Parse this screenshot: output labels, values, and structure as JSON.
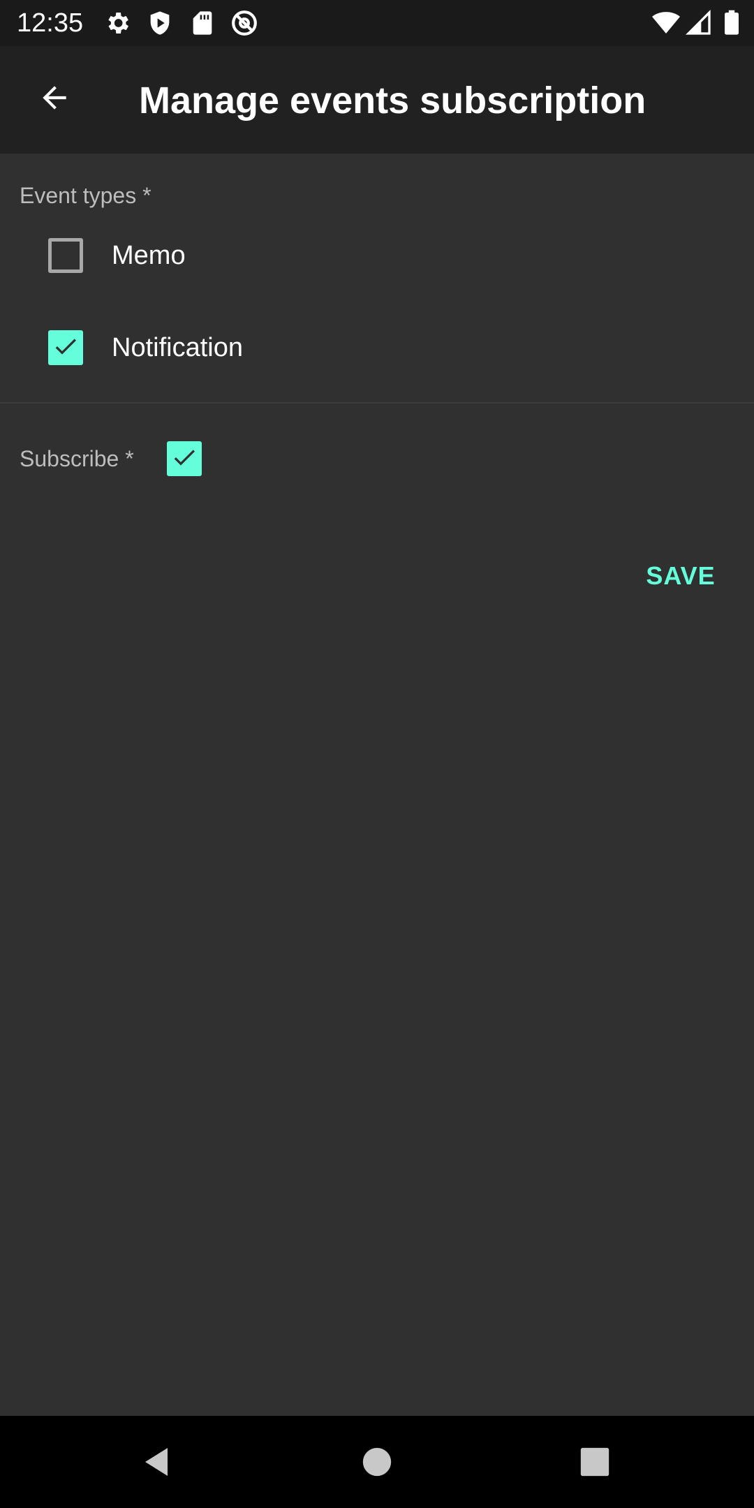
{
  "status_bar": {
    "time": "12:35",
    "left_icons": [
      "gear-icon",
      "shield-icon",
      "sd-card-icon",
      "at-sign-icon"
    ],
    "right_icons": [
      "wifi-icon",
      "signal-icon",
      "battery-icon"
    ]
  },
  "app_bar": {
    "back_icon": "arrow-left-icon",
    "title": "Manage events subscription"
  },
  "form": {
    "event_types_label": "Event types *",
    "event_types": [
      {
        "label": "Memo",
        "checked": false
      },
      {
        "label": "Notification",
        "checked": true
      }
    ],
    "subscribe_label": "Subscribe *",
    "subscribe_checked": true,
    "save_label": "SAVE"
  },
  "nav_bar": {
    "icons": [
      "nav-back-icon",
      "nav-home-icon",
      "nav-recents-icon"
    ]
  },
  "colors": {
    "accent": "#64ffda",
    "background": "#303030",
    "app_bar": "#212121",
    "status_bar": "#1a1a1a"
  }
}
